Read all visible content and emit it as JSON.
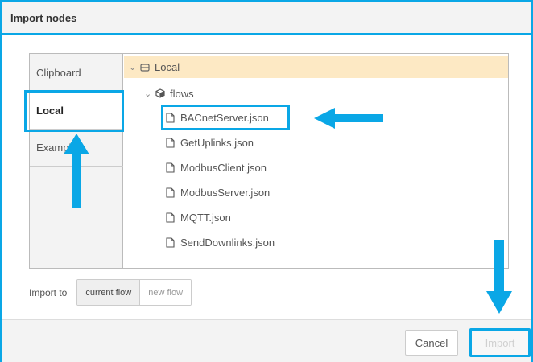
{
  "dialog": {
    "title": "Import nodes"
  },
  "tabs": [
    {
      "label": "Clipboard"
    },
    {
      "label": "Local"
    },
    {
      "label": "Examples"
    }
  ],
  "tree": {
    "root_label": "Local",
    "folder_label": "flows",
    "files": [
      {
        "label": "BACnetServer.json"
      },
      {
        "label": "GetUplinks.json"
      },
      {
        "label": "ModbusClient.json"
      },
      {
        "label": "ModbusServer.json"
      },
      {
        "label": "MQTT.json"
      },
      {
        "label": "SendDownlinks.json"
      }
    ]
  },
  "import_to": {
    "label": "Import to",
    "current_flow": "current flow",
    "new_flow": "new flow"
  },
  "footer": {
    "cancel_label": "Cancel",
    "import_label": "Import"
  },
  "colors": {
    "accent": "#0aa7e6",
    "selected_row": "#fde9c4"
  },
  "icons": {
    "chevron": "chevron-down-icon",
    "drive": "drive-icon",
    "package": "package-icon",
    "file": "file-icon",
    "arrow": "arrow-icon"
  }
}
